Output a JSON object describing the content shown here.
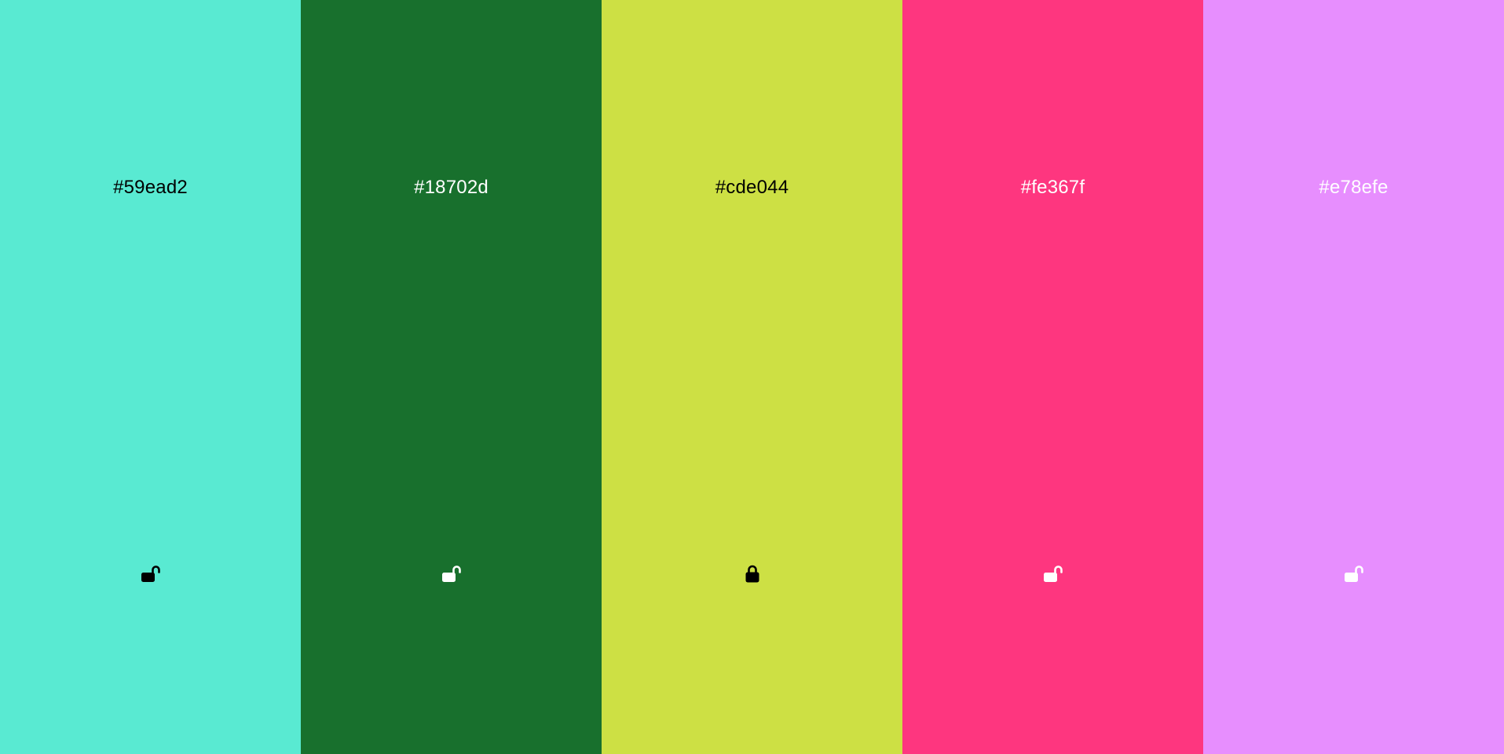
{
  "swatches": [
    {
      "hex": "#59ead2",
      "color": "#59ead2",
      "text_color": "#000000",
      "icon": "lock-open-icon",
      "locked": false
    },
    {
      "hex": "#18702d",
      "color": "#18702d",
      "text_color": "#ffffff",
      "icon": "lock-open-icon",
      "locked": false
    },
    {
      "hex": "#cde044",
      "color": "#cde044",
      "text_color": "#000000",
      "icon": "lock-closed-icon",
      "locked": true
    },
    {
      "hex": "#fe367f",
      "color": "#fe367f",
      "text_color": "#ffffff",
      "icon": "lock-open-icon",
      "locked": false
    },
    {
      "hex": "#e78efe",
      "color": "#e78efe",
      "text_color": "#ffffff",
      "icon": "lock-open-icon",
      "locked": false
    }
  ]
}
